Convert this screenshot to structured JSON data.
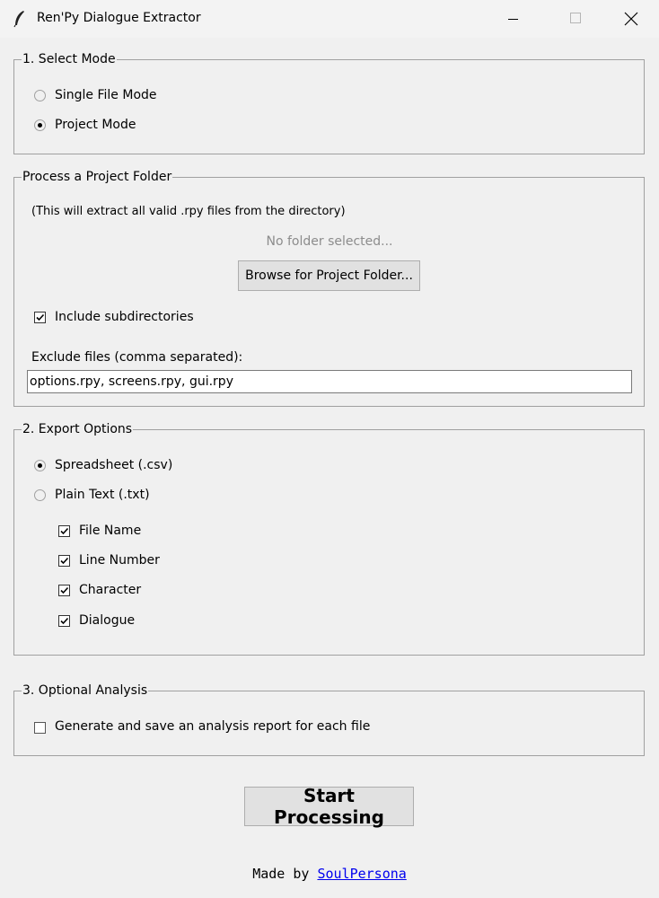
{
  "window": {
    "title": "Ren'Py Dialogue Extractor"
  },
  "mode_section": {
    "legend": "1. Select Mode",
    "options": [
      {
        "label": "Single File Mode",
        "selected": false
      },
      {
        "label": "Project Mode",
        "selected": true
      }
    ]
  },
  "project_section": {
    "legend": "Process a Project Folder",
    "hint": "(This will extract all valid .rpy files from the directory)",
    "folder_status": "No folder selected...",
    "browse_label": "Browse for Project Folder...",
    "include_subdirs_label": "Include subdirectories",
    "include_subdirs_checked": true,
    "exclude_label": "Exclude files (comma separated):",
    "exclude_value": "options.rpy, screens.rpy, gui.rpy"
  },
  "export_section": {
    "legend": "2. Export Options",
    "formats": [
      {
        "label": "Spreadsheet (.csv)",
        "selected": true
      },
      {
        "label": "Plain Text (.txt)",
        "selected": false
      }
    ],
    "columns": [
      {
        "label": "File Name",
        "checked": true
      },
      {
        "label": "Line Number",
        "checked": true
      },
      {
        "label": "Character",
        "checked": true
      },
      {
        "label": "Dialogue",
        "checked": true
      }
    ]
  },
  "analysis_section": {
    "legend": "3. Optional Analysis",
    "report_label": "Generate and save an analysis report for each file",
    "report_checked": false
  },
  "actions": {
    "start_label": "Start Processing"
  },
  "footer": {
    "prefix": "Made by ",
    "author": "SoulPersona"
  }
}
